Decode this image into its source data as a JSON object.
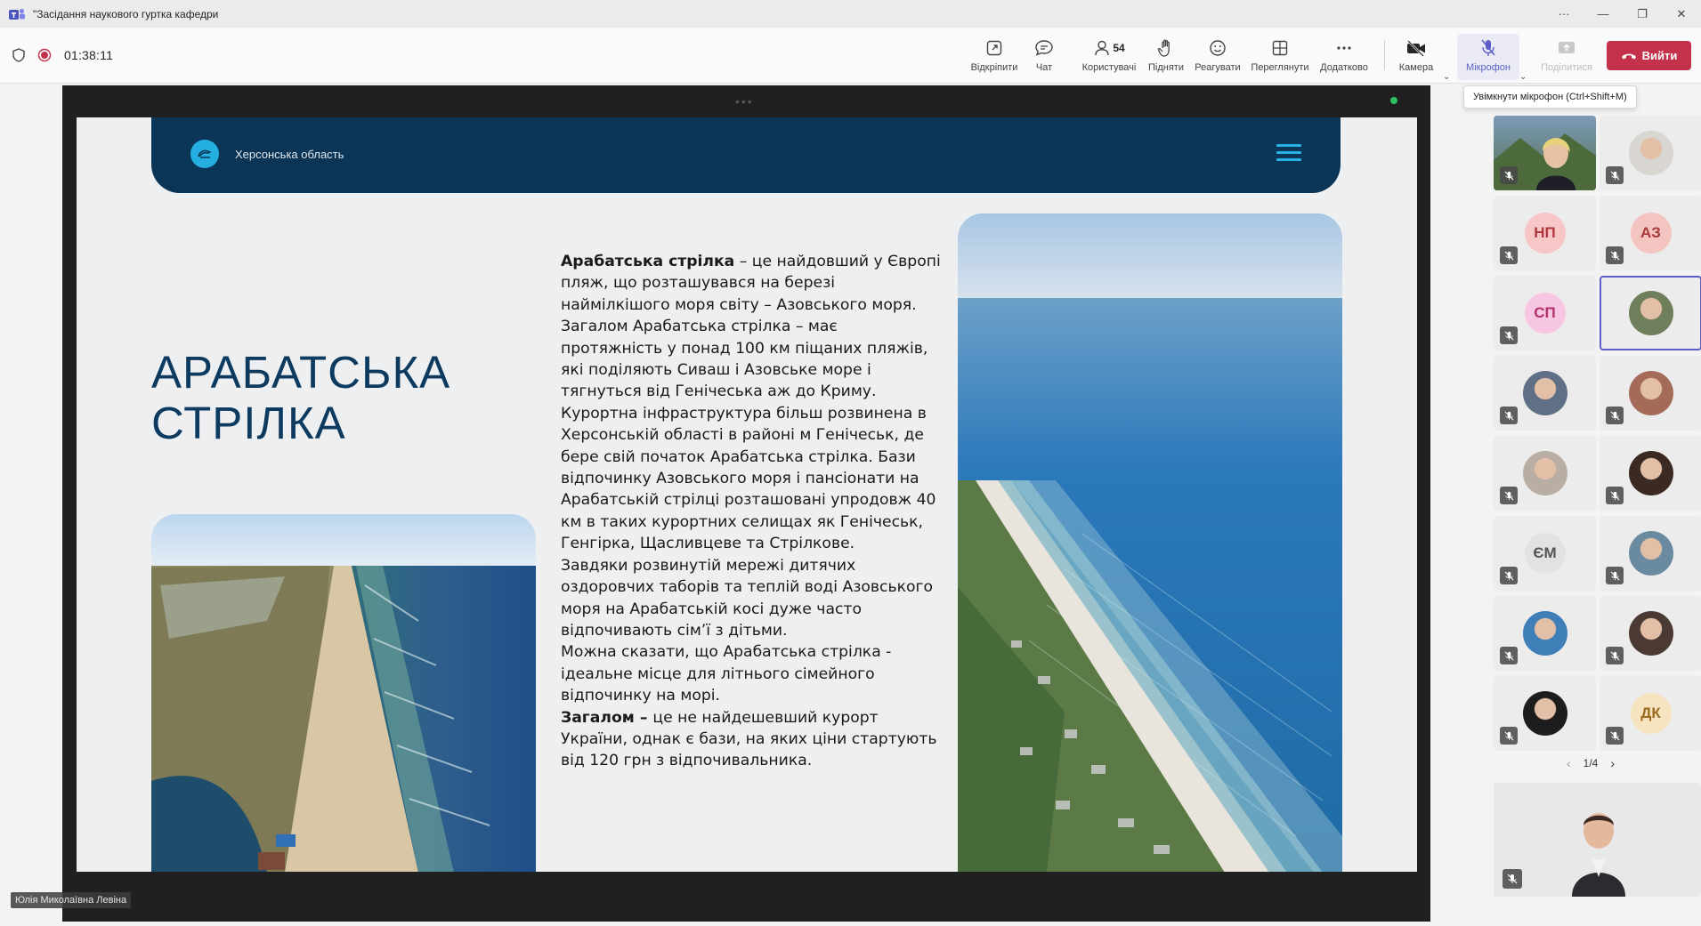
{
  "window": {
    "title": "\"Засідання наукового гуртка кафедри",
    "controls": [
      "more",
      "minimize",
      "restore",
      "close"
    ]
  },
  "meeting": {
    "timer": "01:38:11",
    "toolbar": {
      "popout_label": "Відкріпити",
      "chat_label": "Чат",
      "people_label": "Користувачі",
      "people_count": "54",
      "raise_label": "Підняти",
      "react_label": "Реагувати",
      "view_label": "Переглянути",
      "more_label": "Додатково",
      "camera_label": "Камера",
      "mic_label": "Мікрофон",
      "share_label": "Поділитися",
      "leave_label": "Вийти"
    },
    "tooltip": "Увімкнути мікрофон (Ctrl+Shift+M)"
  },
  "slide": {
    "header_brand": "Херсонська область",
    "title": "АРАБАТСЬКА СТРІЛКА",
    "lead_bold": "Арабатська стрілка",
    "lead_rest": " – це найдовший у Європі пляж, що розташувався на березі наймілкішого моря світу – Азовського моря.",
    "paragraphs": [
      "Загалом Арабатська стрілка – має протяжність у понад 100 км піщаних пляжів, які поділяють Сиваш і Азовське море і тягнуться від Генічеська аж до  Криму.",
      "Курортна інфраструктура більш розвинена в Херсонській області в районі м Генічеськ, де бере свій початок Арабатська стрілка. Бази відпочинку Азовського моря і пансіонати на Арабатській стрілці розташовані упродовж 40 км в таких курортних селищах як Генічеськ, Генгірка, Щасливцеве та Стрілкове.",
      "Завдяки розвинутій мережі дитячих оздоровчих таборів та теплій воді Азовського моря на Арабатській косі дуже часто відпочивають сім’ї з дітьми.",
      "Можна сказати, що Арабатська стрілка - ідеальне місце для літнього сімейного відпочинку на морі."
    ],
    "last_bold": "Загалом – ",
    "last_rest": "це не найдешевший курорт України, однак є бази, на яких ціни стартують від 120 грн з відпочивальника."
  },
  "presenter_name": "Юлія Миколаївна Левіна",
  "participants": [
    {
      "kind": "photo",
      "muted": true,
      "bg": "#6f8a5e"
    },
    {
      "kind": "photo",
      "muted": true,
      "bg": "#d9d6d2"
    },
    {
      "kind": "initials",
      "initials": "НП",
      "muted": true,
      "color": "#f6c7c6",
      "text": "#b0373e"
    },
    {
      "kind": "initials",
      "initials": "АЗ",
      "muted": true,
      "color": "#f4c4c0",
      "text": "#a83a3a"
    },
    {
      "kind": "initials",
      "initials": "СП",
      "muted": true,
      "color": "#f7c6e0",
      "text": "#b1306e"
    },
    {
      "kind": "photo",
      "muted": false,
      "bg": "#6f7f5b",
      "selected": true
    },
    {
      "kind": "photo",
      "muted": true,
      "bg": "#5e6f86"
    },
    {
      "kind": "photo",
      "muted": true,
      "bg": "#a36b58"
    },
    {
      "kind": "photo",
      "muted": true,
      "bg": "#b9aea3"
    },
    {
      "kind": "photo",
      "muted": true,
      "bg": "#3b2a22"
    },
    {
      "kind": "initials",
      "initials": "ЄМ",
      "muted": true,
      "color": "#e3e1e1",
      "text": "#555555"
    },
    {
      "kind": "photo",
      "muted": true,
      "bg": "#6a8aa0"
    },
    {
      "kind": "photo",
      "muted": true,
      "bg": "#3f7fb8"
    },
    {
      "kind": "photo",
      "muted": true,
      "bg": "#4a3a33"
    },
    {
      "kind": "photo",
      "muted": true,
      "bg": "#1d1d1d"
    },
    {
      "kind": "initials",
      "initials": "ДК",
      "muted": true,
      "color": "#f6e3c0",
      "text": "#9a6a1f"
    }
  ],
  "pager": "1/4",
  "colors": {
    "accent": "#5b5fc7",
    "leave": "#c4314b",
    "slide_header": "#0a3556",
    "slide_title": "#0d3a5f",
    "slide_accent": "#25aee0"
  }
}
